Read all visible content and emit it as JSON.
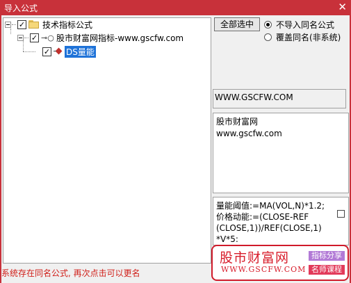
{
  "window": {
    "title": "导入公式",
    "close_glyph": "✕"
  },
  "tree": {
    "root": {
      "label": "技术指标公式",
      "checked": true
    },
    "group": {
      "label": "股市财富网指标-www.gscfw.com",
      "checked": true
    },
    "item": {
      "label": "DS量能",
      "checked": true,
      "selected": true
    }
  },
  "controls": {
    "select_all_label": "全部选中",
    "radio_skip_label": "不导入同名公式",
    "radio_overwrite_label": "覆盖同名(非系统)"
  },
  "info": {
    "site": "WWW.GSCFW.COM",
    "desc_line1": "股市财富网",
    "desc_line2": "www.gscfw.com"
  },
  "code": {
    "lines": [
      "量能阈值:=MA(VOL,N)*1.2;",
      "价格动能:=(CLOSE-REF",
      "(CLOSE,1))/REF(CLOSE,1)",
      "*V*5:"
    ]
  },
  "status": {
    "message": "系统存在同名公式, 再次点击可以更名"
  },
  "watermark": {
    "cn": "股市财富网",
    "en": "WWW.GSCFW.COM",
    "badge1": "指标分享",
    "badge2": "名师课程"
  },
  "colors": {
    "titlebar": "#c8313a",
    "selection": "#1e72d8",
    "status": "#d0201a",
    "badge1": "#b27ad6",
    "badge2": "#e23a5a"
  }
}
